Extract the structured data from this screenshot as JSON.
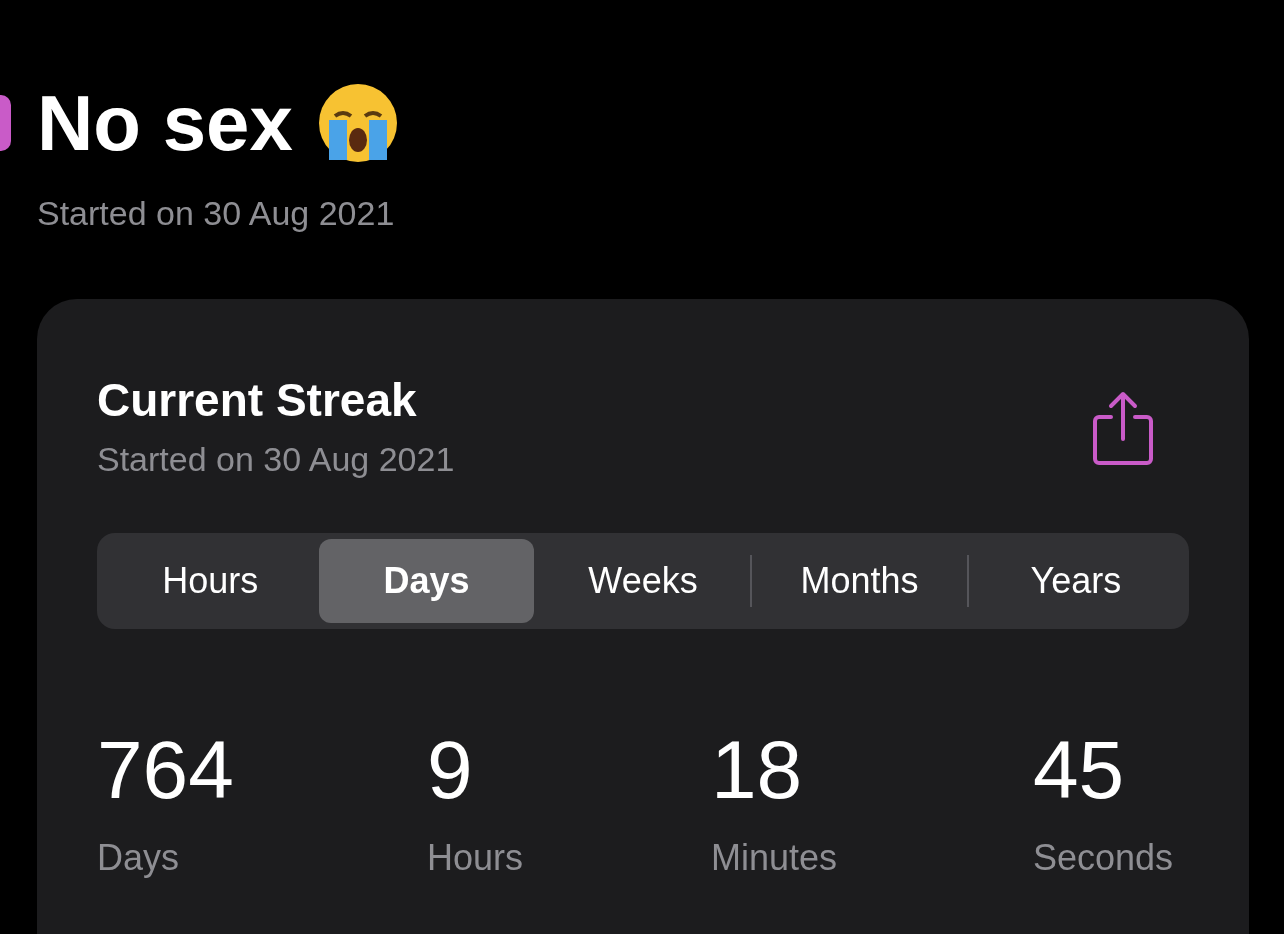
{
  "title": "No sex",
  "subtitle": "Started on 30 Aug 2021",
  "streak": {
    "title": "Current Streak",
    "subtitle": "Started on 30 Aug 2021",
    "segments": [
      {
        "label": "Hours",
        "selected": false
      },
      {
        "label": "Days",
        "selected": true
      },
      {
        "label": "Weeks",
        "selected": false
      },
      {
        "label": "Months",
        "selected": false
      },
      {
        "label": "Years",
        "selected": false
      }
    ],
    "stats": [
      {
        "value": "764",
        "unit": "Days"
      },
      {
        "value": "9",
        "unit": "Hours"
      },
      {
        "value": "18",
        "unit": "Minutes"
      },
      {
        "value": "45",
        "unit": "Seconds"
      }
    ]
  }
}
